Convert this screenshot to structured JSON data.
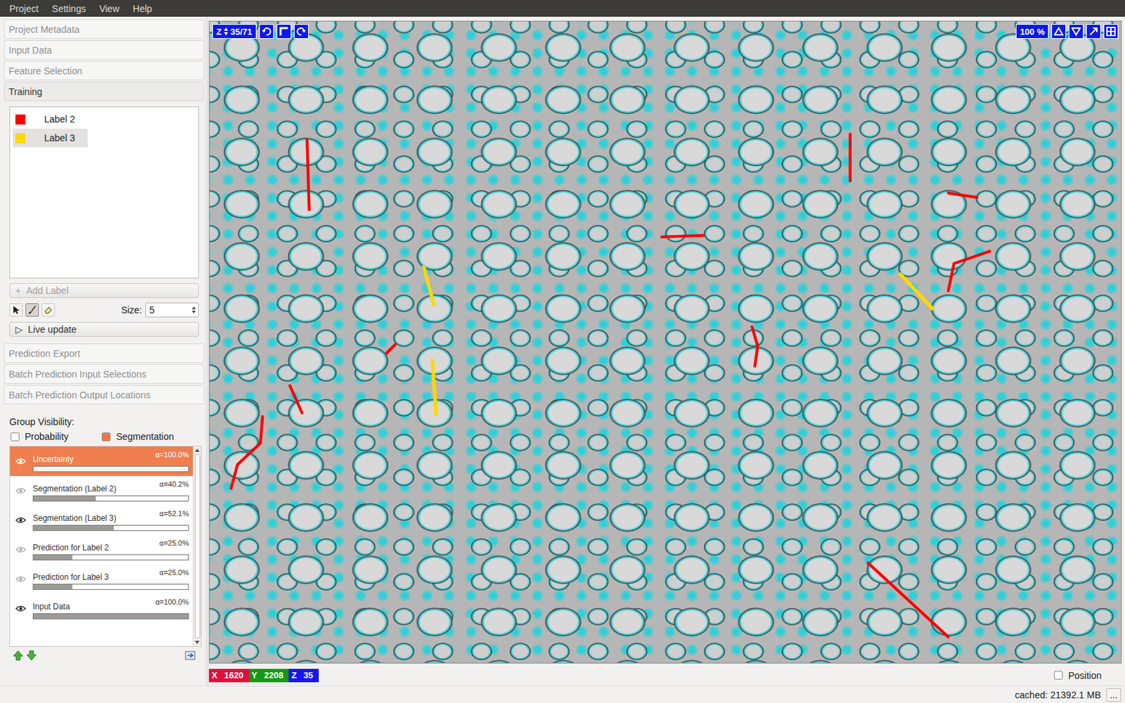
{
  "menu": [
    "Project",
    "Settings",
    "View",
    "Help"
  ],
  "applets": [
    {
      "label": "Project Metadata",
      "expanded": false
    },
    {
      "label": "Input Data",
      "expanded": false
    },
    {
      "label": "Feature Selection",
      "expanded": false
    },
    {
      "label": "Training",
      "expanded": true
    },
    {
      "label": "Prediction Export",
      "expanded": false
    },
    {
      "label": "Batch Prediction Input Selections",
      "expanded": false
    },
    {
      "label": "Batch Prediction Output Locations",
      "expanded": false
    }
  ],
  "training": {
    "labels": [
      {
        "name": "Label 2",
        "color": "#ff0000",
        "selected": false
      },
      {
        "name": "Label 3",
        "color": "#ffd700",
        "selected": true
      }
    ],
    "add_label": {
      "icon": "+",
      "text": "Add Label",
      "disabled": true
    },
    "tools": [
      {
        "name": "navigate",
        "selected": false
      },
      {
        "name": "brush",
        "selected": true
      },
      {
        "name": "eraser",
        "selected": false
      }
    ],
    "size_label": "Size:",
    "size_value": "5",
    "live_update": {
      "icon": "▷",
      "text": "Live update",
      "on": false
    }
  },
  "group_visibility": {
    "title": "Group Visibility:",
    "groups": [
      {
        "label": "Probability",
        "state": "unchecked"
      },
      {
        "label": "Segmentation",
        "state": "partial"
      }
    ]
  },
  "layers": [
    {
      "name": "Uncertainty",
      "opacity": "α=100.0%",
      "level": 1.0,
      "visible": true,
      "selected": true
    },
    {
      "name": "Segmentation (Label 2)",
      "opacity": "α=40.2%",
      "level": 0.402,
      "visible": false,
      "selected": false
    },
    {
      "name": "Segmentation (Label 3)",
      "opacity": "α=52.1%",
      "level": 0.521,
      "visible": true,
      "selected": false
    },
    {
      "name": "Prediction for Label 2",
      "opacity": "α=25.0%",
      "level": 0.25,
      "visible": false,
      "selected": false
    },
    {
      "name": "Prediction for Label 3",
      "opacity": "α=25.0%",
      "level": 0.25,
      "visible": false,
      "selected": false
    },
    {
      "name": "Input Data",
      "opacity": "α=100.0%",
      "level": 1.0,
      "visible": true,
      "selected": false
    }
  ],
  "viewer": {
    "z_label": "Z",
    "slice": "35/71",
    "zoom": "100 %"
  },
  "coords": [
    {
      "axis": "X",
      "value": "1620",
      "color": "#e0103a"
    },
    {
      "axis": "Y",
      "value": "2208",
      "color": "#129a12"
    },
    {
      "axis": "Z",
      "value": "35",
      "color": "#1616f0"
    }
  ],
  "position": {
    "label": "Position",
    "checked": false
  },
  "status": {
    "cached": "cached: 21392.1 MB",
    "more": "..."
  }
}
